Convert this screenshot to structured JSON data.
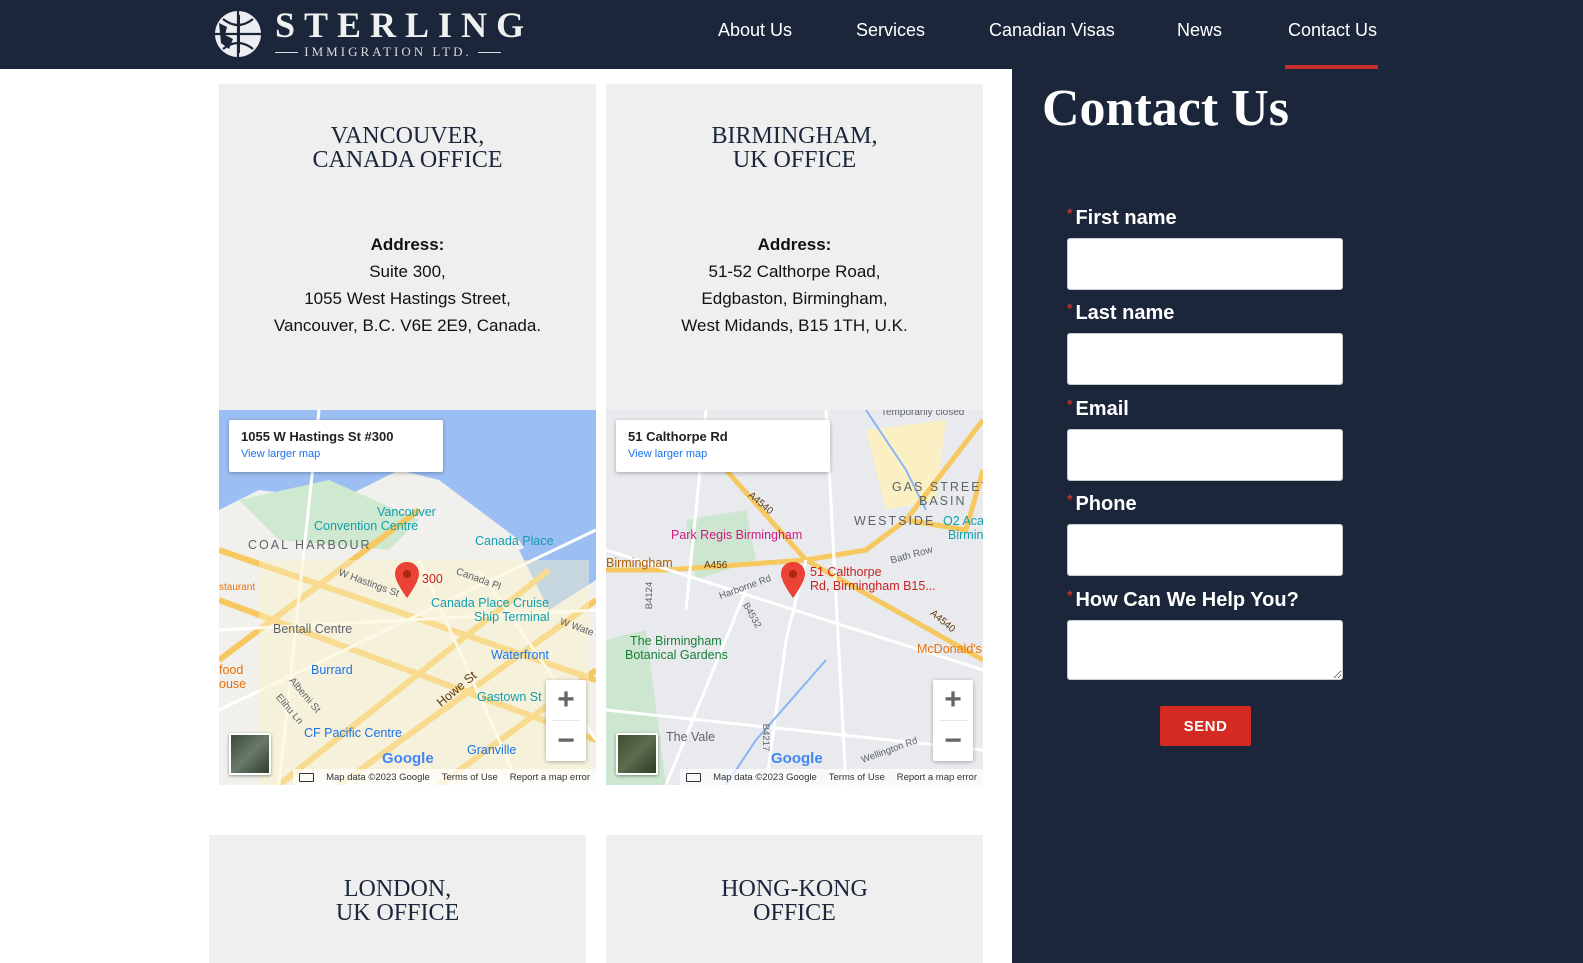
{
  "brand": {
    "name": "STERLING",
    "tagline": "IMMIGRATION LTD."
  },
  "nav": {
    "items": [
      {
        "label": "About Us"
      },
      {
        "label": "Services"
      },
      {
        "label": "Canadian Visas"
      },
      {
        "label": "News"
      },
      {
        "label": "Contact Us",
        "active": true
      }
    ],
    "active_color": "#c6302c"
  },
  "offices": [
    {
      "title_line1": "VANCOUVER,",
      "title_line2": "CANADA OFFICE",
      "address_label": "Address:",
      "address_lines": [
        "Suite 300,",
        "1055 West Hastings Street,",
        "Vancouver, B.C. V6E 2E9, Canada."
      ],
      "map": {
        "place": "1055 W Hastings St #300",
        "link": "View larger map",
        "pin_label": "300",
        "labels": [
          "Vancouver",
          "Convention Centre",
          "COAL HARBOUR",
          "Canada Place",
          "W Hastings St",
          "Canada Pl",
          "Canada Place Cruise",
          "Ship Terminal",
          "Bentall Centre",
          "Waterfront",
          "Burrard",
          "Howe St",
          "Gastown St",
          "Albemi St",
          "Elihu Ln",
          "CF Pacific Centre",
          "Granville",
          "food",
          "ouse",
          "staurant",
          "W Wate"
        ]
      }
    },
    {
      "title_line1": "BIRMINGHAM,",
      "title_line2": "UK OFFICE",
      "address_label": "Address:",
      "address_lines": [
        "51-52 Calthorpe Road,",
        "Edgbaston,  Birmingham,",
        "West Midands, B15 1TH, U.K."
      ],
      "map": {
        "place": "51 Calthorpe Rd",
        "link": "View larger map",
        "pin_label_1": "51 Calthorpe",
        "pin_label_2": "Rd, Birmingham B15...",
        "labels": [
          "Temporarily closed",
          "GAS STREET",
          "BASIN",
          "WESTSIDE",
          "O2 Aca",
          "Birmin",
          "Park Regis Birmingham",
          "A4540",
          "Bath Row",
          "Birmingham",
          "A456",
          "Harborne Rd",
          "B4124",
          "B4532",
          "The Birmingham",
          "Botanical Gardens",
          "McDonald's",
          "The Vale",
          "B4217",
          "Wellington Rd",
          "A4540"
        ]
      }
    },
    {
      "title_line1": "LONDON,",
      "title_line2": "UK OFFICE"
    },
    {
      "title_line1": "HONG-KONG",
      "title_line2": "OFFICE"
    }
  ],
  "map_common": {
    "google": "Google",
    "map_data": "Map data ©2023 Google",
    "terms": "Terms of Use",
    "report": "Report a map error",
    "zoom_in": "+",
    "zoom_out": "−"
  },
  "contact_form": {
    "title": "Contact Us",
    "required_marker": "*",
    "fields": [
      {
        "label": "First name",
        "value": ""
      },
      {
        "label": "Last name",
        "value": ""
      },
      {
        "label": "Email",
        "value": ""
      },
      {
        "label": "Phone",
        "value": ""
      },
      {
        "label": "How Can We Help You?",
        "value": ""
      }
    ],
    "submit_label": "SEND"
  }
}
